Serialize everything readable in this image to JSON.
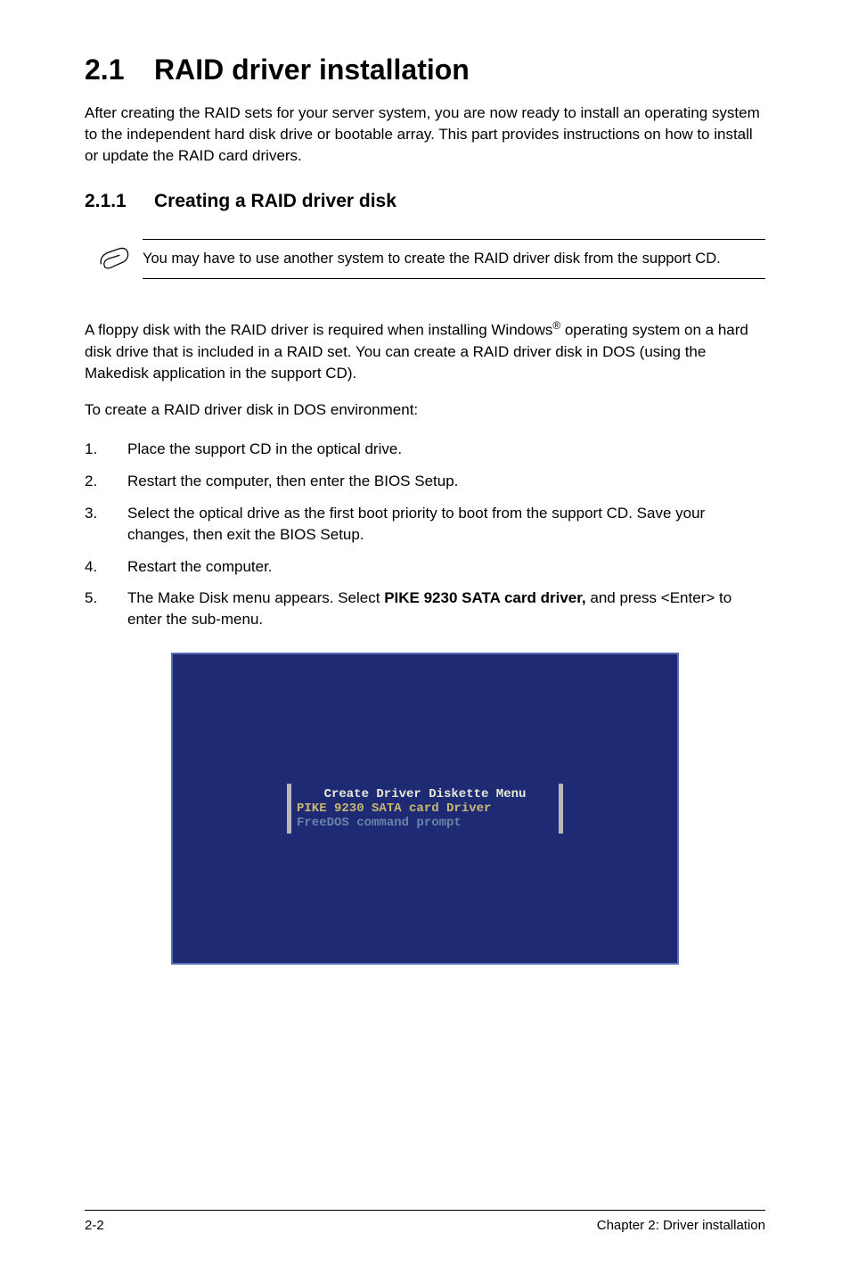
{
  "heading": {
    "number": "2.1",
    "title": "RAID driver installation"
  },
  "intro": "After creating the RAID sets for your server system, you are now ready to install an operating system to the independent hard disk drive or bootable array. This part provides instructions on how to install or update the RAID card drivers.",
  "subheading": {
    "number": "2.1.1",
    "title": "Creating a RAID driver disk"
  },
  "note": "You may have to use another system to create the RAID driver disk from the support CD.",
  "body_para_parts": {
    "p1": "A floppy disk with the RAID driver is required when installing Windows",
    "sup": "®",
    "p2": " operating system on a hard disk drive that is included in a RAID set. You can create a RAID driver disk in DOS (using the Makedisk application in the support CD)."
  },
  "list_intro": "To create a RAID driver disk in DOS environment:",
  "list": [
    {
      "num": "1.",
      "text": "Place the support CD in the optical drive."
    },
    {
      "num": "2.",
      "text": "Restart the computer, then enter the BIOS Setup."
    },
    {
      "num": "3.",
      "text": "Select the optical drive as the first boot priority to boot from the support CD. Save your changes, then exit the BIOS Setup."
    },
    {
      "num": "4.",
      "text": "Restart the computer."
    }
  ],
  "list5": {
    "num": "5.",
    "pre": "The Make Disk menu appears. Select ",
    "bold": "PIKE 9230 SATA card driver,",
    "post": " and press <Enter> to enter the sub-menu."
  },
  "dialog": {
    "title": "Create Driver Diskette Menu",
    "selected": "PIKE 9230 SATA card Driver",
    "item": "FreeDOS command prompt"
  },
  "footer": {
    "left": "2-2",
    "right": "Chapter 2: Driver installation"
  }
}
